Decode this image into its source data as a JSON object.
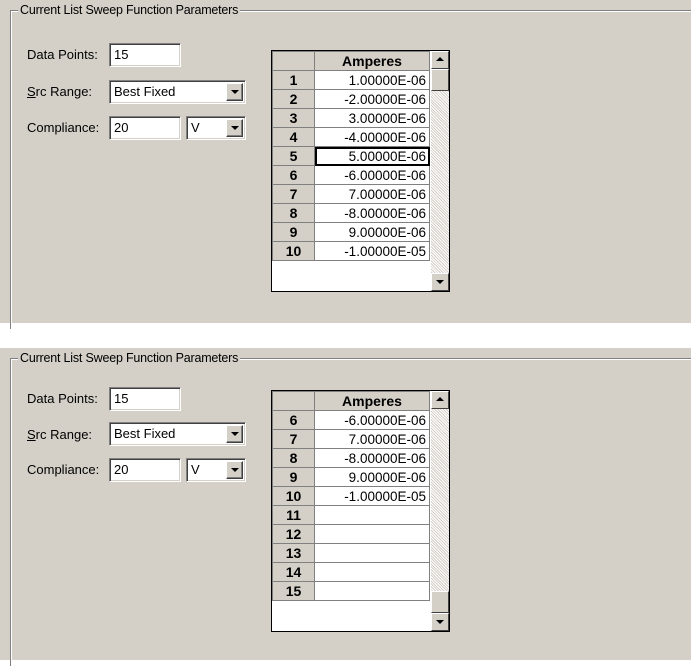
{
  "panels": [
    {
      "group_title": "Current List Sweep Function Parameters",
      "data_points_label": "Data Points:",
      "data_points_value": "15",
      "src_range_label_underlined": "S",
      "src_range_label_rest": "rc Range:",
      "src_range_value": "Best Fixed",
      "compliance_label": "Compliance:",
      "compliance_value": "20",
      "compliance_unit": "V",
      "column_header": "Amperes",
      "scroll_position": 0.0,
      "rows": [
        {
          "index": "1",
          "value": "1.00000E-06"
        },
        {
          "index": "2",
          "value": "-2.00000E-06"
        },
        {
          "index": "3",
          "value": "3.00000E-06"
        },
        {
          "index": "4",
          "value": "-4.00000E-06"
        },
        {
          "index": "5",
          "value": "5.00000E-06"
        },
        {
          "index": "6",
          "value": "-6.00000E-06"
        },
        {
          "index": "7",
          "value": "7.00000E-06"
        },
        {
          "index": "8",
          "value": "-8.00000E-06"
        },
        {
          "index": "9",
          "value": "9.00000E-06"
        },
        {
          "index": "10",
          "value": "-1.00000E-05"
        }
      ]
    },
    {
      "group_title": "Current List Sweep Function Parameters",
      "data_points_label": "Data Points:",
      "data_points_value": "15",
      "src_range_label_underlined": "S",
      "src_range_label_rest": "rc Range:",
      "src_range_value": "Best Fixed",
      "compliance_label": "Compliance:",
      "compliance_value": "20",
      "compliance_unit": "V",
      "column_header": "Amperes",
      "scroll_position": 1.0,
      "rows": [
        {
          "index": "6",
          "value": "-6.00000E-06"
        },
        {
          "index": "7",
          "value": "7.00000E-06"
        },
        {
          "index": "8",
          "value": "-8.00000E-06"
        },
        {
          "index": "9",
          "value": "9.00000E-06"
        },
        {
          "index": "10",
          "value": "-1.00000E-05"
        },
        {
          "index": "11",
          "value": ""
        },
        {
          "index": "12",
          "value": ""
        },
        {
          "index": "13",
          "value": ""
        },
        {
          "index": "14",
          "value": ""
        },
        {
          "index": "15",
          "value": ""
        }
      ]
    }
  ]
}
